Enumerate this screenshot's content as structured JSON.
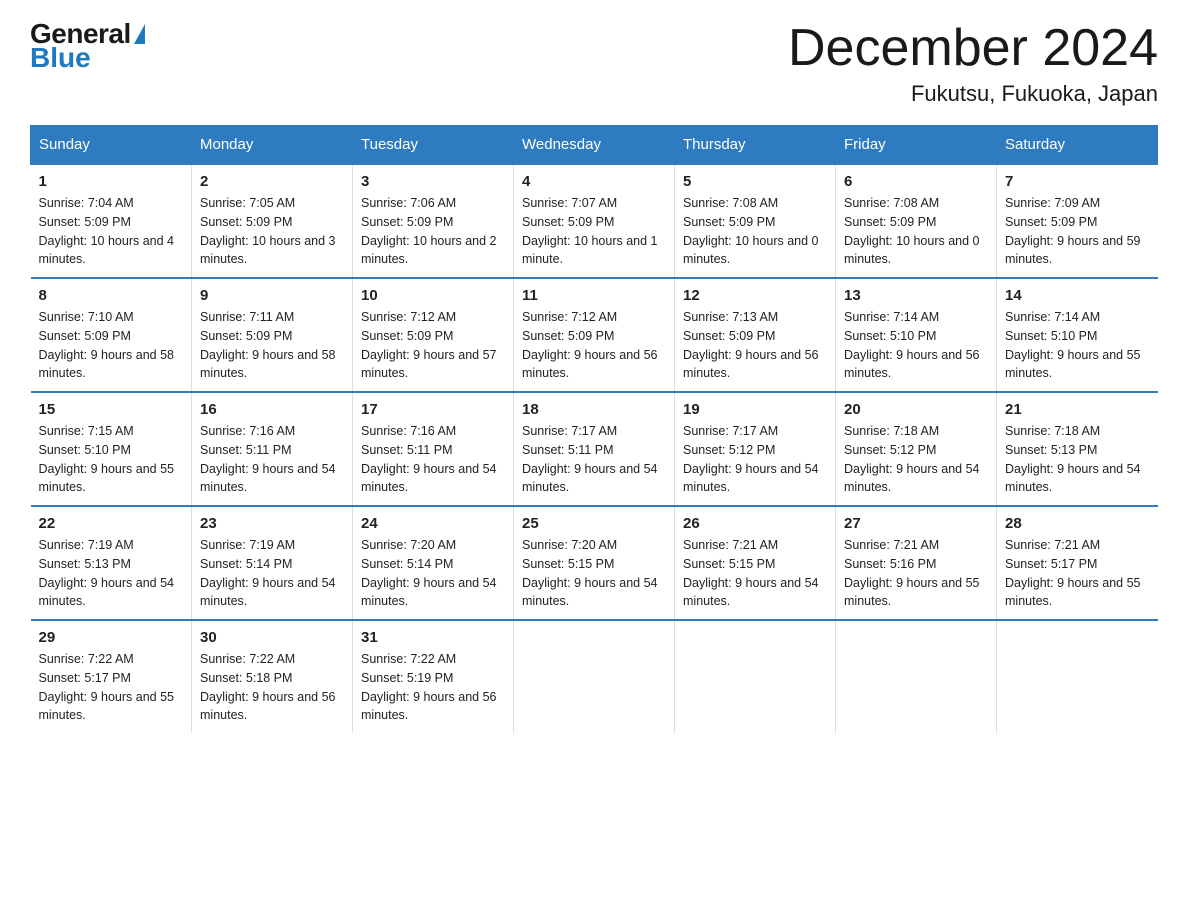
{
  "logo": {
    "top": "General",
    "bottom": "Blue"
  },
  "title": "December 2024",
  "subtitle": "Fukutsu, Fukuoka, Japan",
  "days_of_week": [
    "Sunday",
    "Monday",
    "Tuesday",
    "Wednesday",
    "Thursday",
    "Friday",
    "Saturday"
  ],
  "weeks": [
    [
      {
        "day": "1",
        "sunrise": "7:04 AM",
        "sunset": "5:09 PM",
        "daylight": "10 hours and 4 minutes."
      },
      {
        "day": "2",
        "sunrise": "7:05 AM",
        "sunset": "5:09 PM",
        "daylight": "10 hours and 3 minutes."
      },
      {
        "day": "3",
        "sunrise": "7:06 AM",
        "sunset": "5:09 PM",
        "daylight": "10 hours and 2 minutes."
      },
      {
        "day": "4",
        "sunrise": "7:07 AM",
        "sunset": "5:09 PM",
        "daylight": "10 hours and 1 minute."
      },
      {
        "day": "5",
        "sunrise": "7:08 AM",
        "sunset": "5:09 PM",
        "daylight": "10 hours and 0 minutes."
      },
      {
        "day": "6",
        "sunrise": "7:08 AM",
        "sunset": "5:09 PM",
        "daylight": "10 hours and 0 minutes."
      },
      {
        "day": "7",
        "sunrise": "7:09 AM",
        "sunset": "5:09 PM",
        "daylight": "9 hours and 59 minutes."
      }
    ],
    [
      {
        "day": "8",
        "sunrise": "7:10 AM",
        "sunset": "5:09 PM",
        "daylight": "9 hours and 58 minutes."
      },
      {
        "day": "9",
        "sunrise": "7:11 AM",
        "sunset": "5:09 PM",
        "daylight": "9 hours and 58 minutes."
      },
      {
        "day": "10",
        "sunrise": "7:12 AM",
        "sunset": "5:09 PM",
        "daylight": "9 hours and 57 minutes."
      },
      {
        "day": "11",
        "sunrise": "7:12 AM",
        "sunset": "5:09 PM",
        "daylight": "9 hours and 56 minutes."
      },
      {
        "day": "12",
        "sunrise": "7:13 AM",
        "sunset": "5:09 PM",
        "daylight": "9 hours and 56 minutes."
      },
      {
        "day": "13",
        "sunrise": "7:14 AM",
        "sunset": "5:10 PM",
        "daylight": "9 hours and 56 minutes."
      },
      {
        "day": "14",
        "sunrise": "7:14 AM",
        "sunset": "5:10 PM",
        "daylight": "9 hours and 55 minutes."
      }
    ],
    [
      {
        "day": "15",
        "sunrise": "7:15 AM",
        "sunset": "5:10 PM",
        "daylight": "9 hours and 55 minutes."
      },
      {
        "day": "16",
        "sunrise": "7:16 AM",
        "sunset": "5:11 PM",
        "daylight": "9 hours and 54 minutes."
      },
      {
        "day": "17",
        "sunrise": "7:16 AM",
        "sunset": "5:11 PM",
        "daylight": "9 hours and 54 minutes."
      },
      {
        "day": "18",
        "sunrise": "7:17 AM",
        "sunset": "5:11 PM",
        "daylight": "9 hours and 54 minutes."
      },
      {
        "day": "19",
        "sunrise": "7:17 AM",
        "sunset": "5:12 PM",
        "daylight": "9 hours and 54 minutes."
      },
      {
        "day": "20",
        "sunrise": "7:18 AM",
        "sunset": "5:12 PM",
        "daylight": "9 hours and 54 minutes."
      },
      {
        "day": "21",
        "sunrise": "7:18 AM",
        "sunset": "5:13 PM",
        "daylight": "9 hours and 54 minutes."
      }
    ],
    [
      {
        "day": "22",
        "sunrise": "7:19 AM",
        "sunset": "5:13 PM",
        "daylight": "9 hours and 54 minutes."
      },
      {
        "day": "23",
        "sunrise": "7:19 AM",
        "sunset": "5:14 PM",
        "daylight": "9 hours and 54 minutes."
      },
      {
        "day": "24",
        "sunrise": "7:20 AM",
        "sunset": "5:14 PM",
        "daylight": "9 hours and 54 minutes."
      },
      {
        "day": "25",
        "sunrise": "7:20 AM",
        "sunset": "5:15 PM",
        "daylight": "9 hours and 54 minutes."
      },
      {
        "day": "26",
        "sunrise": "7:21 AM",
        "sunset": "5:15 PM",
        "daylight": "9 hours and 54 minutes."
      },
      {
        "day": "27",
        "sunrise": "7:21 AM",
        "sunset": "5:16 PM",
        "daylight": "9 hours and 55 minutes."
      },
      {
        "day": "28",
        "sunrise": "7:21 AM",
        "sunset": "5:17 PM",
        "daylight": "9 hours and 55 minutes."
      }
    ],
    [
      {
        "day": "29",
        "sunrise": "7:22 AM",
        "sunset": "5:17 PM",
        "daylight": "9 hours and 55 minutes."
      },
      {
        "day": "30",
        "sunrise": "7:22 AM",
        "sunset": "5:18 PM",
        "daylight": "9 hours and 56 minutes."
      },
      {
        "day": "31",
        "sunrise": "7:22 AM",
        "sunset": "5:19 PM",
        "daylight": "9 hours and 56 minutes."
      },
      null,
      null,
      null,
      null
    ]
  ]
}
